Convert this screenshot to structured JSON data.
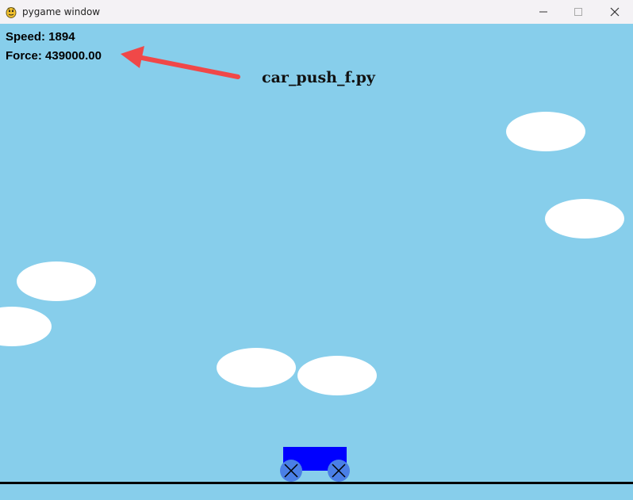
{
  "window": {
    "title": "pygame window",
    "icon": "pygame-snake-icon",
    "controls": {
      "minimize_icon": "minimize-icon",
      "maximize_icon": "maximize-icon",
      "close_icon": "close-icon"
    }
  },
  "game": {
    "hud": {
      "speed_text": "Speed: 1894",
      "force_text": "Force: 439000.00"
    },
    "annotation": {
      "filename": "car_push_f.py",
      "arrow_color": "#f04848"
    },
    "colors": {
      "sky": "#87ceeb",
      "cloud": "#ffffff",
      "car_body": "#0000ff",
      "wheel": "#4a7fe6",
      "ground": "#000000"
    }
  }
}
